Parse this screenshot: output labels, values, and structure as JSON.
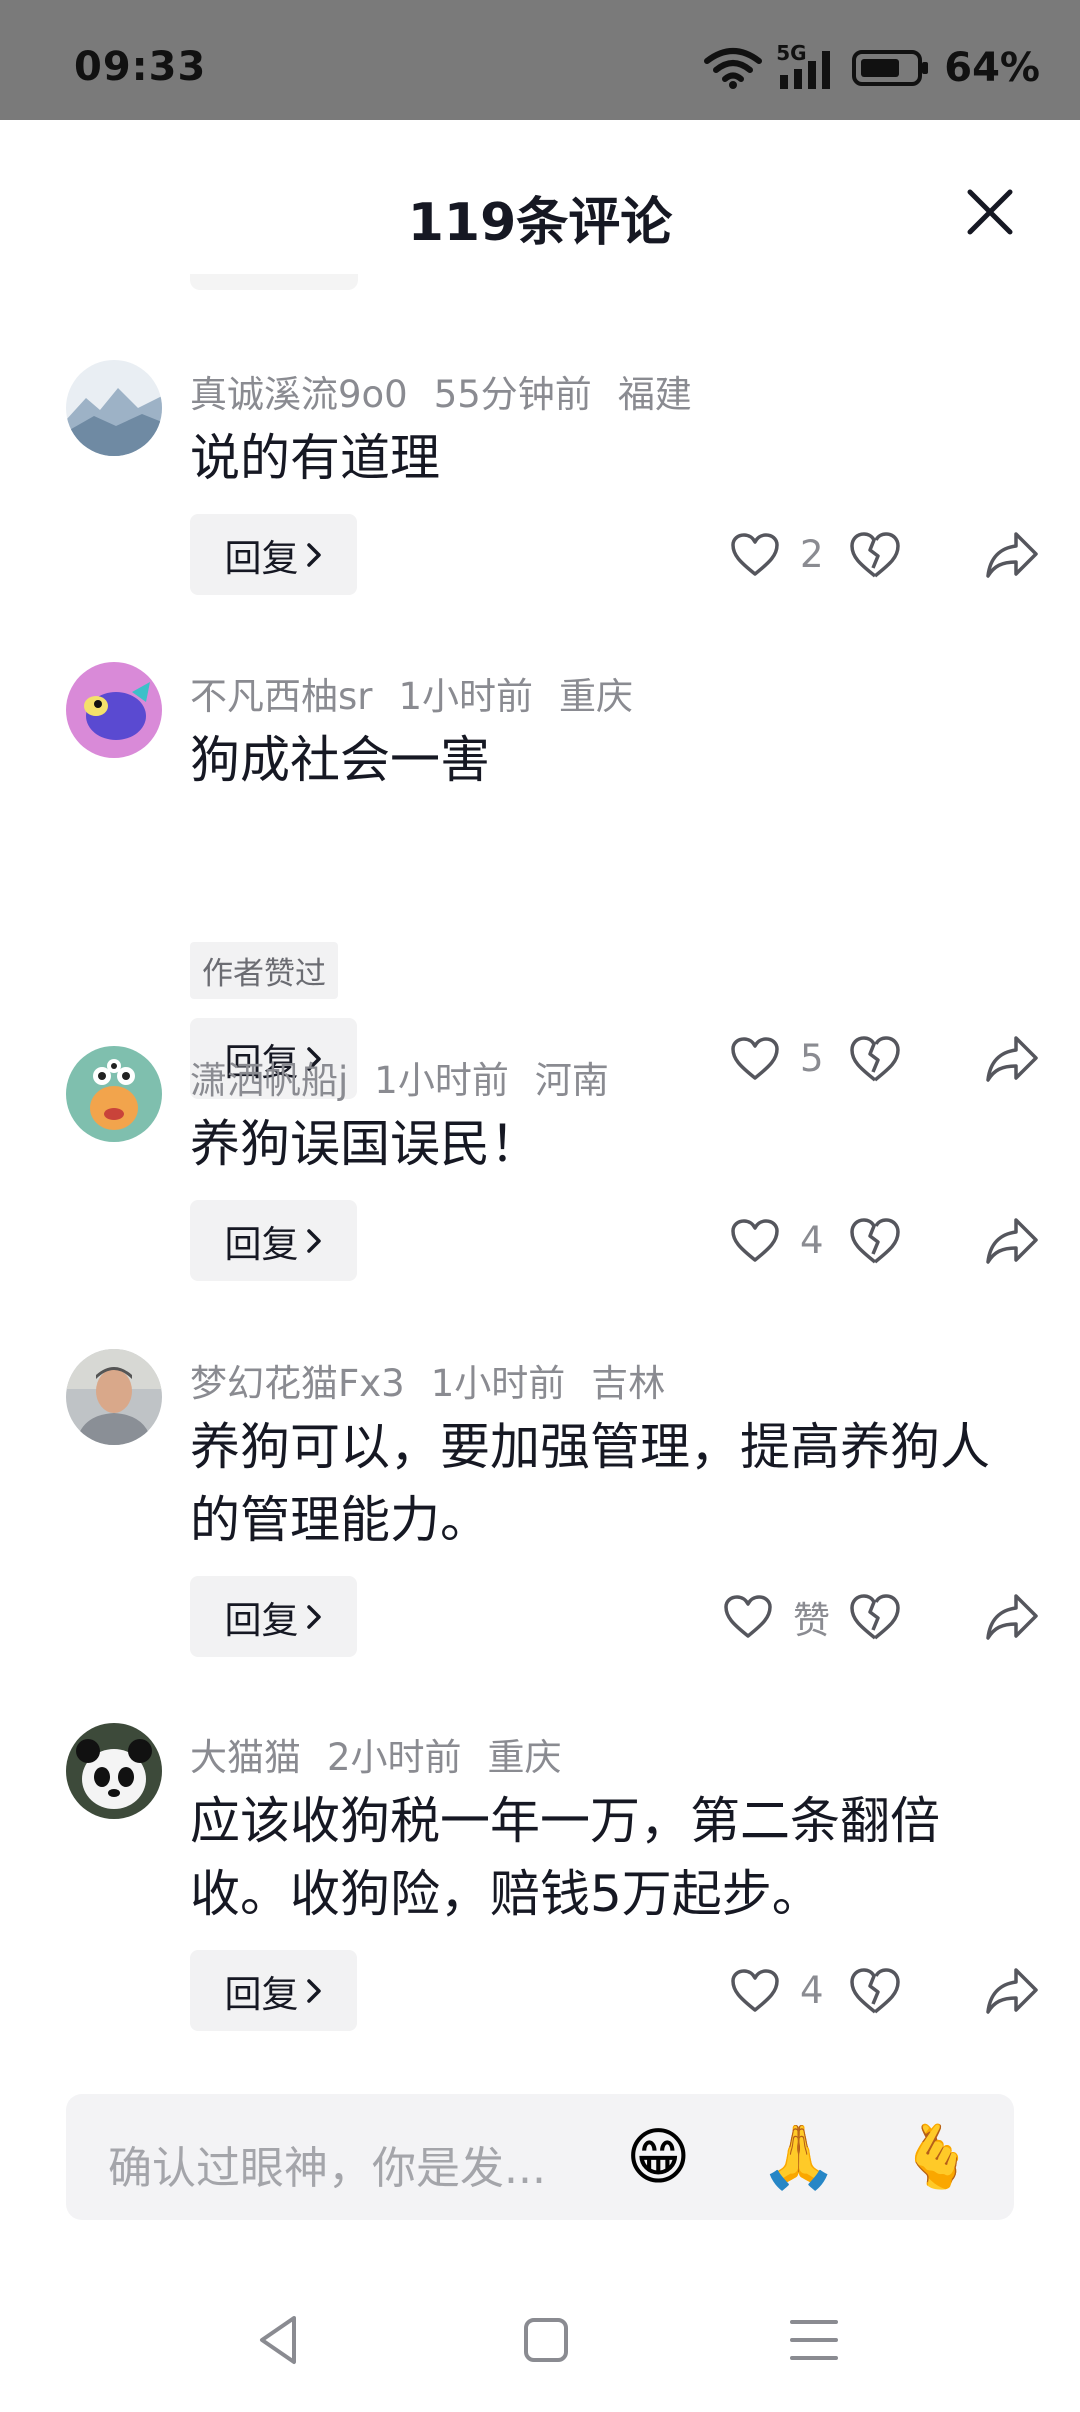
{
  "status_bar": {
    "time": "09:33",
    "network": "5G",
    "battery": "64%"
  },
  "sheet": {
    "title": "119条评论"
  },
  "reply_label": "回复",
  "comments": [
    {
      "username": "真诚溪流9o0",
      "time": "55分钟前",
      "location": "福建",
      "text": "说的有道理",
      "likes": "2",
      "author_liked": false,
      "avatar": "mountain-landscape"
    },
    {
      "username": "不凡西柚sr",
      "time": "1小时前",
      "location": "重庆",
      "text": "狗成社会一害",
      "likes": "5",
      "author_liked": true,
      "author_badge": "作者赞过",
      "avatar": "cartoon-bird"
    },
    {
      "username": "潇洒帆船j",
      "time": "1小时前",
      "location": "河南",
      "text": "养狗误国误民！",
      "likes": "4",
      "author_liked": false,
      "avatar": "cartoon-monster"
    },
    {
      "username": "梦幻花猫Fx3",
      "time": "1小时前",
      "location": "吉林",
      "text": "养狗可以，要加强管理，提高养狗人的管理能力。",
      "likes": "赞",
      "author_liked": false,
      "avatar": "man-photo"
    },
    {
      "username": "大猫猫",
      "time": "2小时前",
      "location": "重庆",
      "text": "应该收狗税一年一万，第二条翻倍收。收狗险，赔钱5万起步。",
      "likes": "4",
      "author_liked": false,
      "avatar": "panda"
    }
  ],
  "input": {
    "placeholder": "确认过眼神，你是发...",
    "emojis": [
      "😁",
      "🙏",
      "🫰"
    ]
  },
  "nav": [
    "back-icon",
    "home-icon",
    "menu-icon"
  ],
  "colors": {
    "text_primary": "#161823",
    "text_secondary": "#8a8b91",
    "chip_bg": "#f2f2f3",
    "status_bar_bg": "#7a7a7a"
  }
}
